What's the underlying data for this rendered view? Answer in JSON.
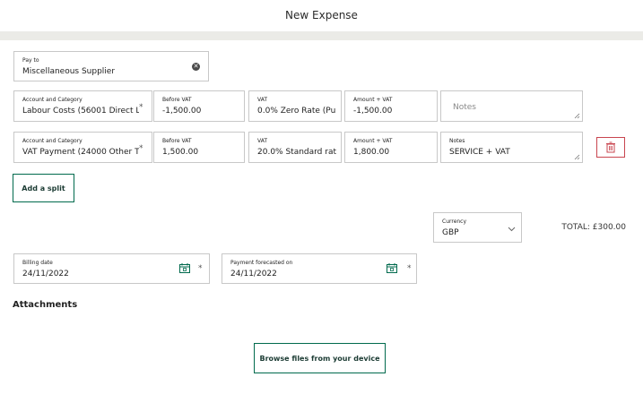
{
  "header": {
    "title": "New Expense"
  },
  "pay_to": {
    "label": "Pay to",
    "value": "Miscellaneous Supplier"
  },
  "splits": [
    {
      "account": {
        "label": "Account and Category",
        "value": "Labour Costs (56001 Direct L"
      },
      "before_vat": {
        "label": "Before VAT",
        "value": "-1,500.00"
      },
      "vat": {
        "label": "VAT",
        "value": "0.0% Zero Rate (Pu"
      },
      "amount_vat": {
        "label": "Amount + VAT",
        "value": "-1,500.00"
      },
      "notes": {
        "placeholder": "Notes"
      }
    },
    {
      "account": {
        "label": "Account and Category",
        "value": "VAT Payment (24000 Other T"
      },
      "before_vat": {
        "label": "Before VAT",
        "value": "1,500.00"
      },
      "vat": {
        "label": "VAT",
        "value": "20.0% Standard rat"
      },
      "amount_vat": {
        "label": "Amount + VAT",
        "value": "1,800.00"
      },
      "notes": {
        "label": "Notes",
        "value": "SERVICE + VAT"
      }
    }
  ],
  "required_marker": "*",
  "add_split_label": "Add a split",
  "currency": {
    "label": "Currency",
    "value": "GBP"
  },
  "total": "TOTAL: £300.00",
  "billing_date": {
    "label": "Billing date",
    "value": "24/11/2022"
  },
  "payment_forecast": {
    "label": "Payment forecasted on",
    "value": "24/11/2022"
  },
  "attachments": {
    "title": "Attachments",
    "browse_label": "Browse files from your device"
  },
  "colors": {
    "accent": "#006a4d",
    "danger": "#c8454f",
    "band": "#ebebe7"
  },
  "icons": [
    "clear-icon",
    "trash-icon",
    "calendar-icon",
    "chevron-down-icon",
    "resize-handle-icon"
  ]
}
